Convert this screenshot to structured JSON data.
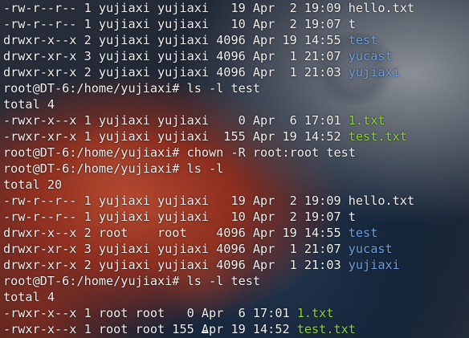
{
  "colors": {
    "text": "#f1f1f1",
    "directory": "#6c9fe0",
    "executable": "#8cd23a"
  },
  "lines": [
    [
      {
        "t": "-rw-r--r-- 1 yujiaxi yujiaxi   19 Apr  2 19:09 ",
        "c": "default"
      },
      {
        "t": "hello.txt",
        "c": "default"
      }
    ],
    [
      {
        "t": "-rw-r--r-- 1 yujiaxi yujiaxi   10 Apr  2 19:07 ",
        "c": "default"
      },
      {
        "t": "t",
        "c": "default"
      }
    ],
    [
      {
        "t": "drwxr-x--x 2 yujiaxi yujiaxi 4096 Apr 19 14:55 ",
        "c": "default"
      },
      {
        "t": "test",
        "c": "dir"
      }
    ],
    [
      {
        "t": "drwxr-xr-x 3 yujiaxi yujiaxi 4096 Apr  1 21:07 ",
        "c": "default"
      },
      {
        "t": "yucast",
        "c": "dir"
      }
    ],
    [
      {
        "t": "drwxr-xr-x 2 yujiaxi yujiaxi 4096 Apr  1 21:03 ",
        "c": "default"
      },
      {
        "t": "yujiaxi",
        "c": "dir"
      }
    ],
    [
      {
        "t": "root@DT-6:/home/yujiaxi# ls -l test",
        "c": "default"
      }
    ],
    [
      {
        "t": "total 4",
        "c": "default"
      }
    ],
    [
      {
        "t": "-rwxr-x--x 1 yujiaxi yujiaxi    0 Apr  6 17:01 ",
        "c": "default"
      },
      {
        "t": "1.txt",
        "c": "exec"
      }
    ],
    [
      {
        "t": "-rwxr-xr-x 1 yujiaxi yujiaxi  155 Apr 19 14:52 ",
        "c": "default"
      },
      {
        "t": "test.txt",
        "c": "exec"
      }
    ],
    [
      {
        "t": "root@DT-6:/home/yujiaxi# chown -R root:root test",
        "c": "default"
      }
    ],
    [
      {
        "t": "root@DT-6:/home/yujiaxi# ls -l",
        "c": "default"
      }
    ],
    [
      {
        "t": "total 20",
        "c": "default"
      }
    ],
    [
      {
        "t": "-rw-r--r-- 1 yujiaxi yujiaxi   19 Apr  2 19:09 ",
        "c": "default"
      },
      {
        "t": "hello.txt",
        "c": "default"
      }
    ],
    [
      {
        "t": "-rw-r--r-- 1 yujiaxi yujiaxi   10 Apr  2 19:07 ",
        "c": "default"
      },
      {
        "t": "t",
        "c": "default"
      }
    ],
    [
      {
        "t": "drwxr-x--x 2 root    root    4096 Apr 19 14:55 ",
        "c": "default"
      },
      {
        "t": "test",
        "c": "dir"
      }
    ],
    [
      {
        "t": "drwxr-xr-x 3 yujiaxi yujiaxi 4096 Apr  1 21:07 ",
        "c": "default"
      },
      {
        "t": "yucast",
        "c": "dir"
      }
    ],
    [
      {
        "t": "drwxr-xr-x 2 yujiaxi yujiaxi 4096 Apr  1 21:03 ",
        "c": "default"
      },
      {
        "t": "yujiaxi",
        "c": "dir"
      }
    ],
    [
      {
        "t": "root@DT-6:/home/yujiaxi# ls -l test",
        "c": "default"
      }
    ],
    [
      {
        "t": "total 4",
        "c": "default"
      }
    ],
    [
      {
        "t": "-rwxr-x--x 1 root root   0 Apr  6 17:01 ",
        "c": "default"
      },
      {
        "t": "1.txt",
        "c": "exec"
      }
    ],
    [
      {
        "t": "-rwxr-x--x 1 root root 155 Apr 19 14:52 ",
        "c": "default"
      },
      {
        "t": "test.txt",
        "c": "exec"
      }
    ]
  ]
}
